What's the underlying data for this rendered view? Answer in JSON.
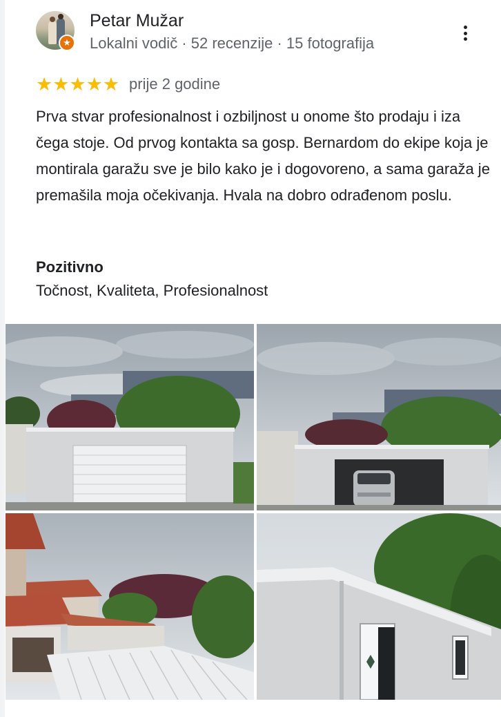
{
  "reviewer": {
    "name": "Petar Mužar",
    "meta": "Lokalni vodič · 52 recenzije · 15 fotografija",
    "badge_icon": "local-guide-star-icon"
  },
  "review": {
    "rating": 5,
    "stars_text": "★★★★★",
    "date": "prije 2 godine",
    "text": "Prva stvar profesionalnost i ozbiljnost u onome što prodaju i iza čega stoje. Od prvog kontakta sa gosp. Bernardom do ekipe koja je montirala garažu sve je bilo kako je i dogovoreno, a sama garaža je premašila moja očekivanja. Hvala na dobro odrađenom poslu."
  },
  "highlights": {
    "title": "Pozitivno",
    "values": "Točnost, Kvaliteta, Profesionalnost"
  },
  "colors": {
    "star": "#fbbc04",
    "badge": "#e8710a",
    "secondary_text": "#5f6368"
  }
}
